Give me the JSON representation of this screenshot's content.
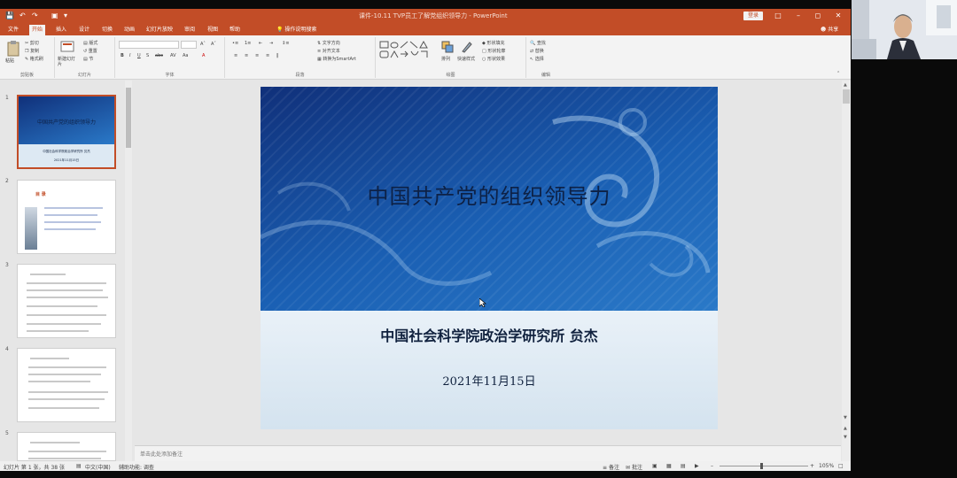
{
  "window": {
    "title": "课件-10.11 TVP员工了解党组织领导力 - PowerPoint",
    "signin": "登录",
    "share": "共享"
  },
  "quick_access": [
    "save-icon",
    "undo-icon",
    "redo-icon",
    "slideshow-icon"
  ],
  "tabs": [
    "文件",
    "开始",
    "插入",
    "设计",
    "切换",
    "动画",
    "幻灯片放映",
    "审阅",
    "视图",
    "帮助"
  ],
  "active_tab": "开始",
  "tell_me": "操作说明搜索",
  "ribbon": {
    "clipboard": {
      "label": "剪贴板",
      "paste": "粘贴",
      "cut": "剪切",
      "copy": "复制",
      "format_painter": "格式刷"
    },
    "slides": {
      "label": "幻灯片",
      "new_slide": "新建幻灯片",
      "layout": "版式",
      "reset": "重置",
      "section": "节"
    },
    "font": {
      "label": "字体"
    },
    "paragraph": {
      "label": "段落",
      "text_direction": "文字方向",
      "align_text": "对齐文本",
      "smartart": "转换为SmartArt"
    },
    "drawing": {
      "label": "绘图",
      "arrange": "排列",
      "quick_styles": "快速样式",
      "shape_fill": "形状填充",
      "shape_outline": "形状轮廓",
      "shape_effects": "形状效果"
    },
    "editing": {
      "label": "编辑",
      "find": "查找",
      "replace": "替换",
      "select": "选择"
    }
  },
  "thumbnails": [
    {
      "num": "1",
      "type": "title",
      "title": "中国共产党的组织领导力",
      "subtitle": "中国社会科学院政治学研究所 贠杰",
      "date": "2021年11月15日",
      "selected": true
    },
    {
      "num": "2",
      "type": "toc",
      "heading": "目 录"
    },
    {
      "num": "3",
      "type": "text"
    },
    {
      "num": "4",
      "type": "text"
    },
    {
      "num": "5",
      "type": "text"
    }
  ],
  "slide": {
    "title": "中国共产党的组织领导力",
    "subtitle": "中国社会科学院政治学研究所    贠杰",
    "date": "2021年11月15日"
  },
  "notes_placeholder": "单击此处添加备注",
  "status": {
    "slide_counter": "幻灯片 第 1 张，共 38 张",
    "language": "中文(中国)",
    "accessibility": "辅助功能: 调查",
    "notes": "备注",
    "comments": "批注",
    "zoom": "105%"
  },
  "colors": {
    "accent": "#c24d27",
    "slide_dark": "#10307a",
    "slide_light": "#dde9f3"
  }
}
